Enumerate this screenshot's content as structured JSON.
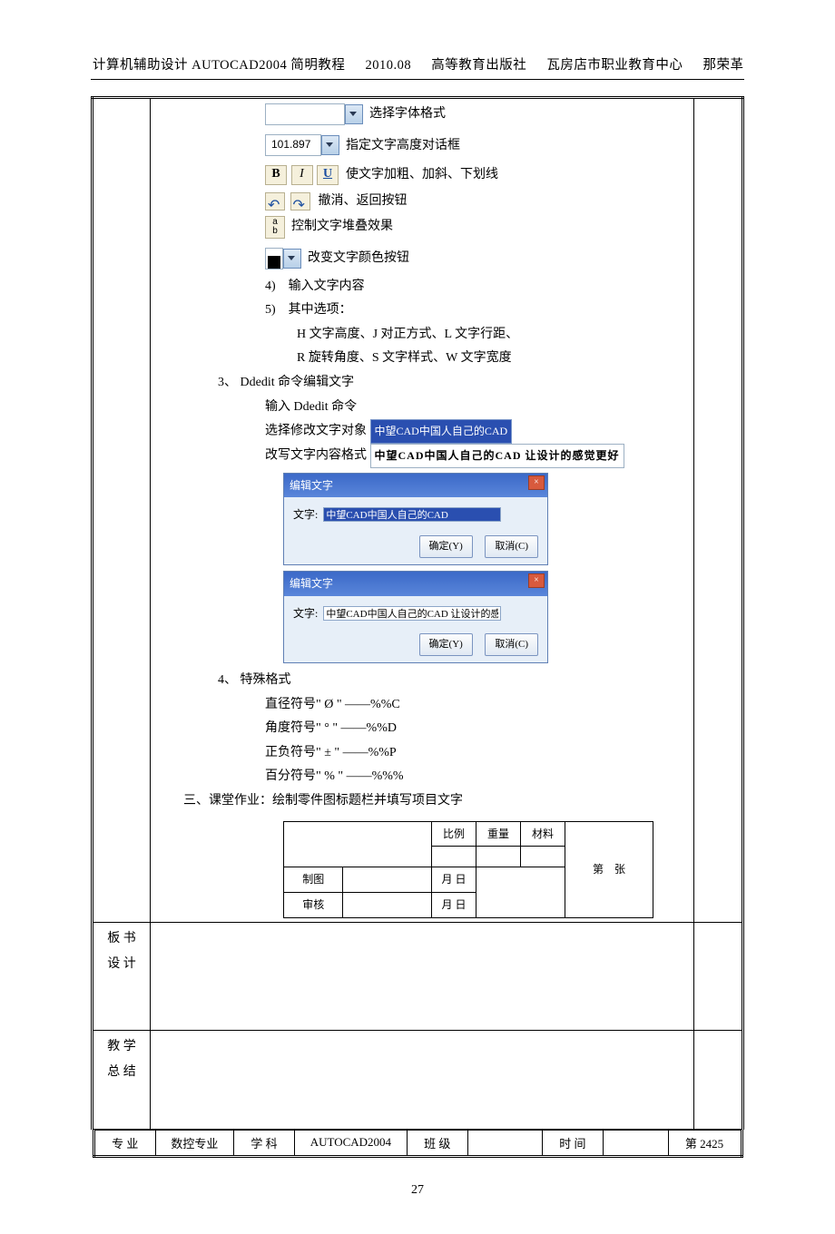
{
  "header": {
    "t1": "计算机辅助设计 AUTOCAD2004 简明教程",
    "t2": "2010.08",
    "t3": "高等教育出版社",
    "t4": "瓦房店市职业教育中心",
    "t5": "那荣革"
  },
  "ui": {
    "font_select_text": "选择字体格式",
    "height_val": "101.897",
    "height_text": "指定文字高度对话框",
    "biu_text": "使文字加粗、加斜、下划线",
    "undo_text": "撤消、返回按钮",
    "stack_text": "控制文字堆叠效果",
    "color_text": "改变文字颜色按钮",
    "item4": "4)　输入文字内容",
    "item5": "5)　其中选项：",
    "opt1": "H 文字高度、J 对正方式、L 文字行距、",
    "opt2": "R 旋转角度、S 文字样式、W 文字宽度",
    "sec3": "3、 Ddedit 命令编辑文字",
    "dd_input": "输入 Ddedit 命令",
    "dd_select": "选择修改文字对象",
    "dd_sel_val": "中望CAD中国人自己的CAD",
    "dd_change": "改写文字内容格式",
    "dd_change_val": "中望CAD中国人自己的CAD 让设计的感觉更好",
    "dlg_title": "编辑文字",
    "dlg_label": "文字:",
    "dlg_val1": "中望CAD中国人自己的CAD",
    "dlg_val2": "中望CAD中国人自己的CAD 让设计的感觉更好",
    "btn_ok": "确定(Y)",
    "btn_cancel": "取消(C)",
    "sec4": "4、 特殊格式",
    "sp1": "直径符号\" Ø \" ——%%C",
    "sp2": "角度符号\" ° \" ——%%D",
    "sp3": "正负符号\" ± \" ——%%P",
    "sp4": "百分符号\" % \" ——%%%",
    "work": "三、课堂作业：绘制零件图标题栏并填写项目文字",
    "tb": {
      "bl": "比例",
      "zl": "重量",
      "cl": "材料",
      "di": "第",
      "zhang": "张",
      "zt": "制图",
      "date": "月  日",
      "sh": "审核"
    }
  },
  "rows": {
    "bs": "板 书\n设 计",
    "jx": "教 学\n总 结"
  },
  "info": {
    "c1": "专 业",
    "c2": "数控专业",
    "c3": "学 科",
    "c4": "AUTOCAD2004",
    "c5": "班 级",
    "c6": "",
    "c7": "时 间",
    "c8": "",
    "c9": "第 2425"
  },
  "pageno": "27"
}
